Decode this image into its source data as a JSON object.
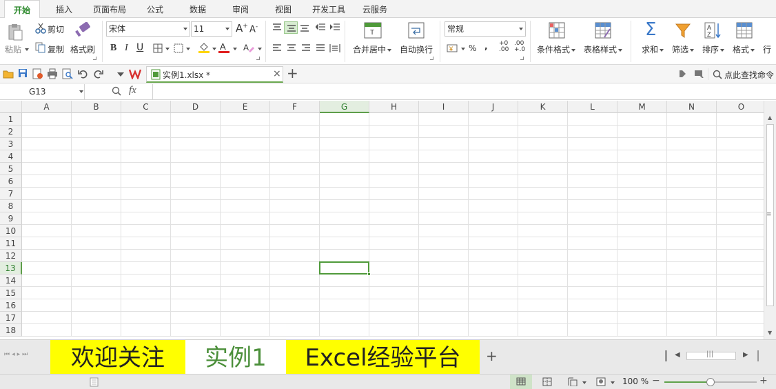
{
  "ribbon_tabs": [
    "开始",
    "插入",
    "页面布局",
    "公式",
    "数据",
    "审阅",
    "视图",
    "开发工具",
    "云服务"
  ],
  "active_tab": "开始",
  "clipboard": {
    "paste": "粘贴",
    "cut": "剪切",
    "copy": "复制",
    "format_painter": "格式刷"
  },
  "font": {
    "name": "宋体",
    "size": "11"
  },
  "alignment": {
    "merge_center": "合并居中",
    "wrap_text": "自动换行"
  },
  "number": {
    "format": "常规",
    "percent": "%",
    "comma": ","
  },
  "styles": {
    "conditional_format": "条件格式",
    "table_style": "表格样式"
  },
  "editing": {
    "sum": "求和",
    "filter": "筛选",
    "sort": "排序",
    "format": "格式",
    "row": "行"
  },
  "quick_access": {
    "doc_tab": "实例1.xlsx *",
    "search": "点此查找命令",
    "add_tab": "+"
  },
  "formula_bar": {
    "name_box": "G13",
    "fx": "fx",
    "formula": ""
  },
  "grid": {
    "columns": [
      "A",
      "B",
      "C",
      "D",
      "E",
      "F",
      "G",
      "H",
      "I",
      "J",
      "K",
      "L",
      "M",
      "N",
      "O"
    ],
    "rows": [
      "1",
      "2",
      "3",
      "4",
      "5",
      "6",
      "7",
      "8",
      "9",
      "10",
      "11",
      "12",
      "13",
      "14",
      "15",
      "16",
      "17",
      "18"
    ],
    "selected_column": "G",
    "selected_row": "13"
  },
  "sheet_tabs": [
    {
      "label": "欢迎关注",
      "highlight": true
    },
    {
      "label": "实例1",
      "active": true
    },
    {
      "label": "Excel经验平台",
      "highlight": true
    }
  ],
  "status": {
    "zoom": "100 %",
    "zoom_fraction": 0.5
  },
  "colors": {
    "accent": "#4f9a3a",
    "highlight_tab": "#ffff00",
    "active_sheet_text": "#4b8f3a"
  }
}
